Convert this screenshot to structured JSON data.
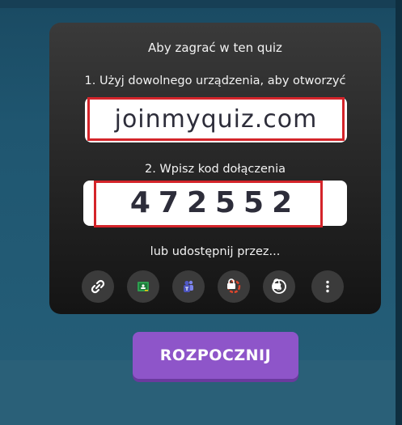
{
  "card": {
    "title": "Aby zagrać w ten quiz",
    "step1": "1. Użyj dowolnego urządzenia, aby otworzyć",
    "url": "joinmyquiz.com",
    "step2": "2. Wpisz kod dołączenia",
    "code": "472552",
    "share_label": "lub udostępnij przez..."
  },
  "share_icons": [
    {
      "name": "link-icon",
      "locked": false
    },
    {
      "name": "google-classroom-icon",
      "locked": false
    },
    {
      "name": "microsoft-teams-icon",
      "locked": false
    },
    {
      "name": "remind-icon",
      "locked": true
    },
    {
      "name": "schoology-icon",
      "locked": true
    },
    {
      "name": "more-options-icon",
      "locked": false
    }
  ],
  "start_button": {
    "label": "ROZPOCZNIJ"
  },
  "colors": {
    "accent": "#8e55c9",
    "highlight": "#d4242a",
    "card": "#1e1e1e"
  }
}
